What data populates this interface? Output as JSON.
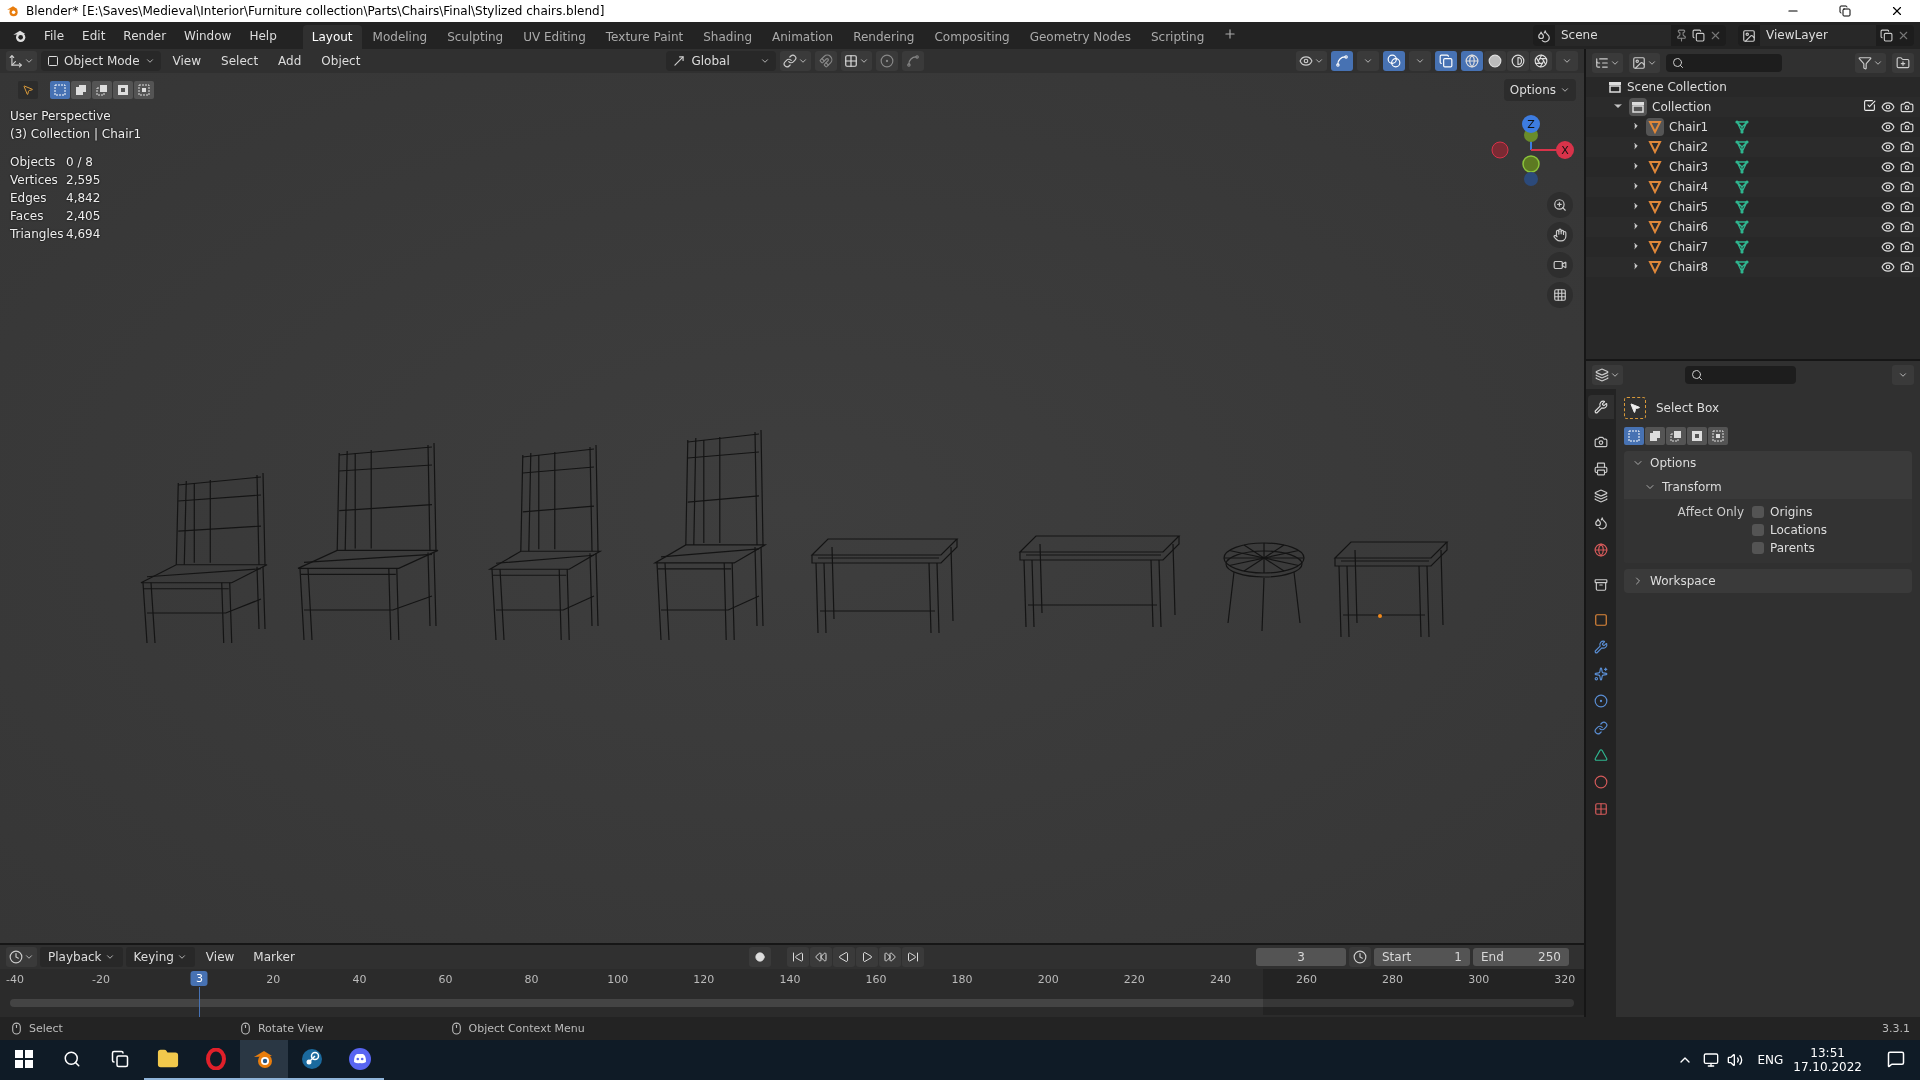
{
  "window": {
    "title": "Blender* [E:\\Saves\\Medieval\\Interior\\Furniture collection\\Parts\\Chairs\\Final\\Stylized chairs.blend]"
  },
  "menu": [
    "File",
    "Edit",
    "Render",
    "Window",
    "Help"
  ],
  "workspaces": [
    {
      "label": "Layout",
      "selected": true
    },
    {
      "label": "Modeling",
      "selected": false
    },
    {
      "label": "Sculpting",
      "selected": false
    },
    {
      "label": "UV Editing",
      "selected": false
    },
    {
      "label": "Texture Paint",
      "selected": false
    },
    {
      "label": "Shading",
      "selected": false
    },
    {
      "label": "Animation",
      "selected": false
    },
    {
      "label": "Rendering",
      "selected": false
    },
    {
      "label": "Compositing",
      "selected": false
    },
    {
      "label": "Geometry Nodes",
      "selected": false
    },
    {
      "label": "Scripting",
      "selected": false
    }
  ],
  "scene": "Scene",
  "view_layer": "ViewLayer",
  "viewport": {
    "mode": "Object Mode",
    "menus": [
      "View",
      "Select",
      "Add",
      "Object"
    ],
    "orientation": "Global",
    "options": "Options",
    "selection_modes": [
      {
        "selected": true
      },
      {
        "selected": false
      },
      {
        "selected": false
      },
      {
        "selected": false
      },
      {
        "selected": false
      }
    ],
    "shading_modes": [
      {
        "selected": true
      },
      {
        "selected": false
      },
      {
        "selected": false
      },
      {
        "selected": false
      }
    ],
    "perspective": "User Perspective",
    "context": "(3) Collection | Chair1",
    "stats": [
      {
        "label": "Objects",
        "value": "0 / 8"
      },
      {
        "label": "Vertices",
        "value": "2,595"
      },
      {
        "label": "Edges",
        "value": "4,842"
      },
      {
        "label": "Faces",
        "value": "2,405"
      },
      {
        "label": "Triangles",
        "value": "4,694"
      }
    ],
    "gizmo": {
      "z": "Z",
      "x": "X"
    }
  },
  "outliner": {
    "root": "Scene Collection",
    "collections": [
      {
        "name": "Collection",
        "checked": true,
        "expanded": true,
        "children": [
          {
            "name": "Chair1",
            "selected": true,
            "expanded": false
          },
          {
            "name": "Chair2",
            "selected": false,
            "expanded": false
          },
          {
            "name": "Chair3",
            "selected": false,
            "expanded": false
          },
          {
            "name": "Chair4",
            "selected": false,
            "expanded": false
          },
          {
            "name": "Chair5",
            "selected": false,
            "expanded": false
          },
          {
            "name": "Chair6",
            "selected": false,
            "expanded": false
          },
          {
            "name": "Chair7",
            "selected": false,
            "expanded": false
          },
          {
            "name": "Chair8",
            "selected": false,
            "expanded": false
          }
        ]
      }
    ]
  },
  "properties": {
    "tabs": [
      {
        "selected": true
      },
      {
        "selected": false
      },
      {
        "selected": false
      },
      {
        "selected": false
      },
      {
        "selected": false
      },
      {
        "selected": false
      },
      {
        "selected": false
      },
      {
        "selected": false
      },
      {
        "selected": false
      },
      {
        "selected": false
      },
      {
        "selected": false
      },
      {
        "selected": false
      },
      {
        "selected": false
      },
      {
        "selected": false
      },
      {
        "selected": false
      }
    ],
    "tool": "Select Box",
    "selection_modes": [
      {
        "selected": true
      },
      {
        "selected": false
      },
      {
        "selected": false
      },
      {
        "selected": false
      },
      {
        "selected": false
      }
    ],
    "panels": [
      {
        "title": "Options",
        "expanded": true,
        "subpanels": [
          {
            "title": "Transform",
            "expanded": true,
            "label": "Affect Only",
            "options": [
              {
                "label": "Origins",
                "checked": false
              },
              {
                "label": "Locations",
                "checked": false
              },
              {
                "label": "Parents",
                "checked": false
              }
            ]
          }
        ]
      },
      {
        "title": "Workspace",
        "expanded": false
      }
    ]
  },
  "timeline": {
    "menus": [
      "Playback",
      "Keying",
      "View",
      "Marker"
    ],
    "current_frame": "3",
    "start_label": "Start",
    "start": "1",
    "end_label": "End",
    "end": "250",
    "ruler": [
      "-40",
      "-20",
      "20",
      "40",
      "60",
      "80",
      "100",
      "120",
      "140",
      "160",
      "180",
      "200",
      "220",
      "240",
      "260",
      "280",
      "300",
      "320"
    ],
    "playhead": {
      "label": "3",
      "level": 0.119
    }
  },
  "status_bar": {
    "hints": [
      "Select",
      "Rotate View",
      "Object Context Menu"
    ],
    "version": "3.3.1"
  },
  "taskbar": {
    "apps": [
      {
        "selected": false
      },
      {
        "selected": false
      },
      {
        "selected": true
      },
      {
        "selected": false
      },
      {
        "selected": false
      }
    ],
    "language": "ENG",
    "time": "13:51",
    "date": "17.10.2022"
  }
}
